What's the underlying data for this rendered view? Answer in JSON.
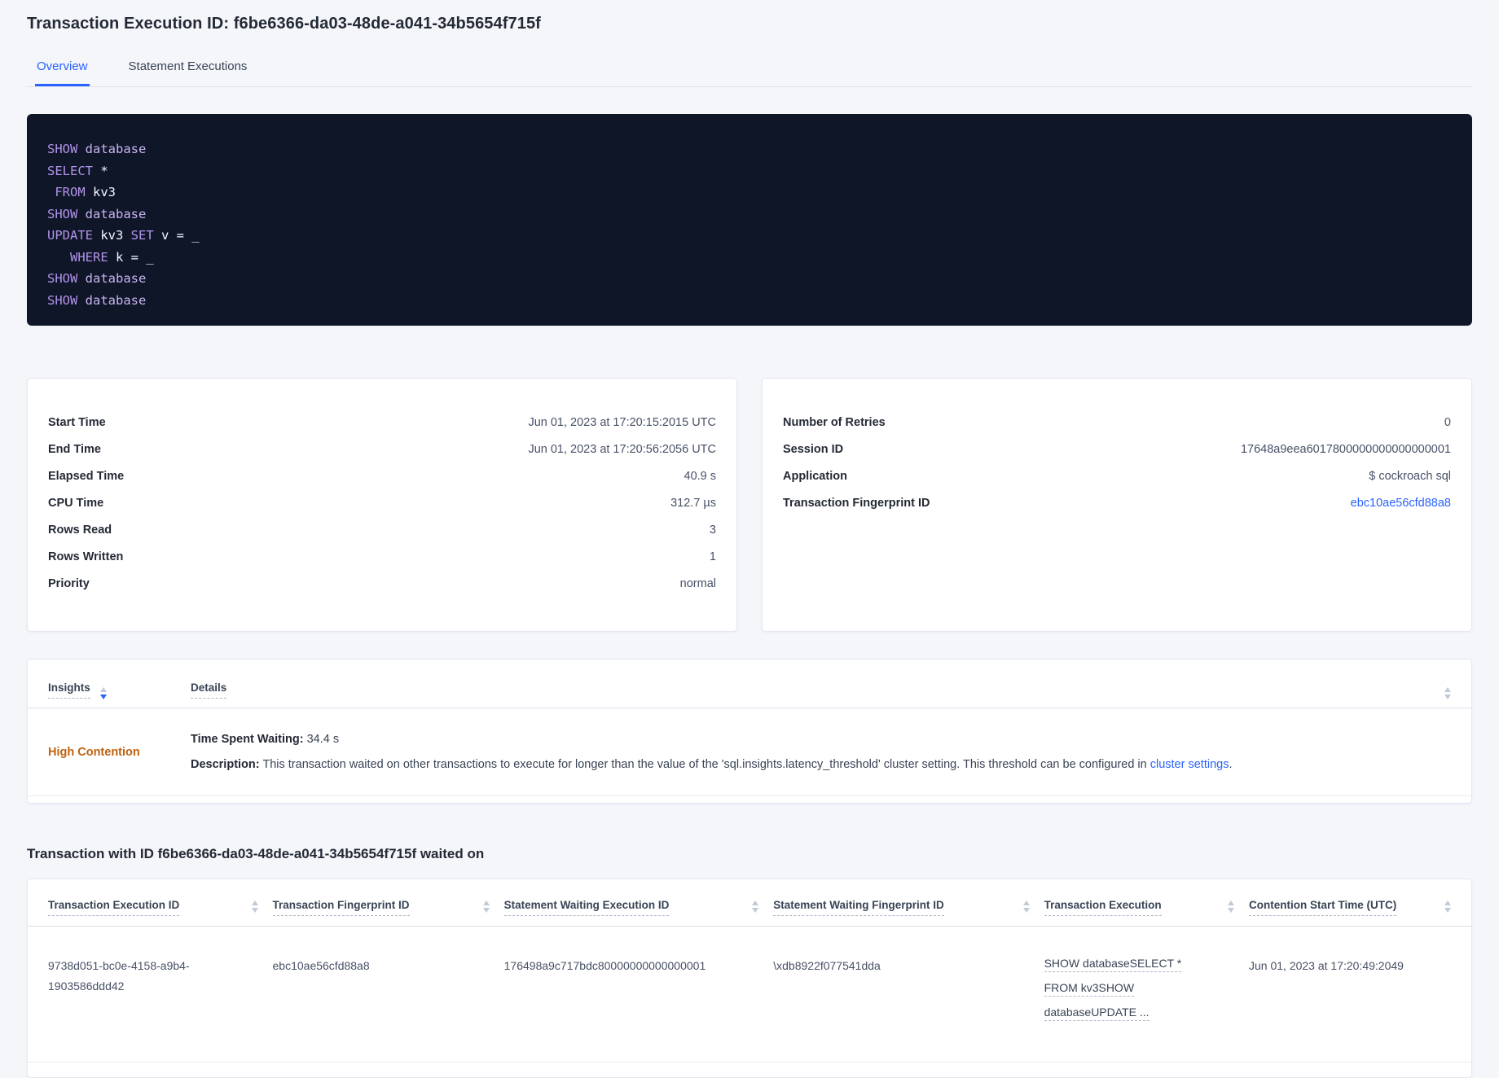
{
  "page": {
    "title": "Transaction Execution ID: f6be6366-da03-48de-a041-34b5654f715f"
  },
  "tabs": [
    {
      "label": "Overview",
      "active": true
    },
    {
      "label": "Statement Executions",
      "active": false
    }
  ],
  "colors": {
    "accent_blue": "#2962ff",
    "warning_orange": "#c0610e",
    "code_background": "#0e1628",
    "code_keyword": "#b392ea",
    "page_background": "#f4f6fa"
  },
  "sql_box": {
    "lines": [
      [
        {
          "t": "kw",
          "s": "SHOW"
        },
        {
          "t": "pl",
          "s": " "
        },
        {
          "t": "kw2",
          "s": "database"
        }
      ],
      [
        {
          "t": "kw",
          "s": "SELECT"
        },
        {
          "t": "pl",
          "s": " *"
        }
      ],
      [
        {
          "t": "pl",
          "s": " "
        },
        {
          "t": "kw",
          "s": "FROM"
        },
        {
          "t": "pl",
          "s": " kv3"
        }
      ],
      [
        {
          "t": "kw",
          "s": "SHOW"
        },
        {
          "t": "pl",
          "s": " "
        },
        {
          "t": "kw2",
          "s": "database"
        }
      ],
      [
        {
          "t": "kw",
          "s": "UPDATE"
        },
        {
          "t": "pl",
          "s": " kv3 "
        },
        {
          "t": "kw",
          "s": "SET"
        },
        {
          "t": "pl",
          "s": " v = _"
        }
      ],
      [
        {
          "t": "pl",
          "s": "   "
        },
        {
          "t": "kw",
          "s": "WHERE"
        },
        {
          "t": "pl",
          "s": " k = _"
        }
      ],
      [
        {
          "t": "kw",
          "s": "SHOW"
        },
        {
          "t": "pl",
          "s": " "
        },
        {
          "t": "kw2",
          "s": "database"
        }
      ],
      [
        {
          "t": "kw",
          "s": "SHOW"
        },
        {
          "t": "pl",
          "s": " "
        },
        {
          "t": "kw2",
          "s": "database"
        }
      ]
    ]
  },
  "summary_left": {
    "rows": [
      {
        "label": "Start Time",
        "value": "Jun 01, 2023 at 17:20:15:2015 UTC"
      },
      {
        "label": "End Time",
        "value": "Jun 01, 2023 at 17:20:56:2056 UTC"
      },
      {
        "label": "Elapsed Time",
        "value": "40.9 s"
      },
      {
        "label": "CPU Time",
        "value": "312.7 µs"
      },
      {
        "label": "Rows Read",
        "value": "3"
      },
      {
        "label": "Rows Written",
        "value": "1"
      },
      {
        "label": "Priority",
        "value": "normal"
      }
    ]
  },
  "summary_right": {
    "rows": [
      {
        "label": "Number of Retries",
        "value": "0"
      },
      {
        "label": "Session ID",
        "value": "17648a9eea6017800000000000000001"
      },
      {
        "label": "Application",
        "value": "$ cockroach sql"
      },
      {
        "label": "Transaction Fingerprint ID",
        "value": "ebc10ae56cfd88a8"
      }
    ]
  },
  "insights_table": {
    "columns": [
      {
        "label": "Insights"
      },
      {
        "label": "Details"
      }
    ],
    "row": {
      "insight": "High Contention",
      "waiting_label": "Time Spent Waiting:",
      "waiting_value": " 34.4 s",
      "description_label": "Description:",
      "description_text": " This transaction waited on other transactions to execute for longer than the value of the 'sql.insights.latency_threshold' cluster setting. This threshold can be configured in ",
      "description_link": "cluster settings",
      "description_suffix": "."
    }
  },
  "waited_on": {
    "heading": "Transaction with ID f6be6366-da03-48de-a041-34b5654f715f waited on",
    "columns": [
      "Transaction Execution ID",
      "Transaction Fingerprint ID",
      "Statement Waiting Execution ID",
      "Statement Waiting Fingerprint ID",
      "Transaction Execution",
      "Contention Start Time (UTC)"
    ],
    "row": {
      "transaction_execution_id": "9738d051-bc0e-4158-a9b4-1903586ddd42",
      "transaction_fingerprint_id": "ebc10ae56cfd88a8",
      "statement_waiting_execution_id": "176498a9c717bdc80000000000000001",
      "statement_waiting_fingerprint_id": "\\xdb8922f077541dda",
      "transaction_execution_lines": [
        "SHOW databaseSELECT *",
        "FROM kv3SHOW",
        "databaseUPDATE ..."
      ],
      "contention_start_time": "Jun 01, 2023 at 17:20:49:2049"
    }
  }
}
